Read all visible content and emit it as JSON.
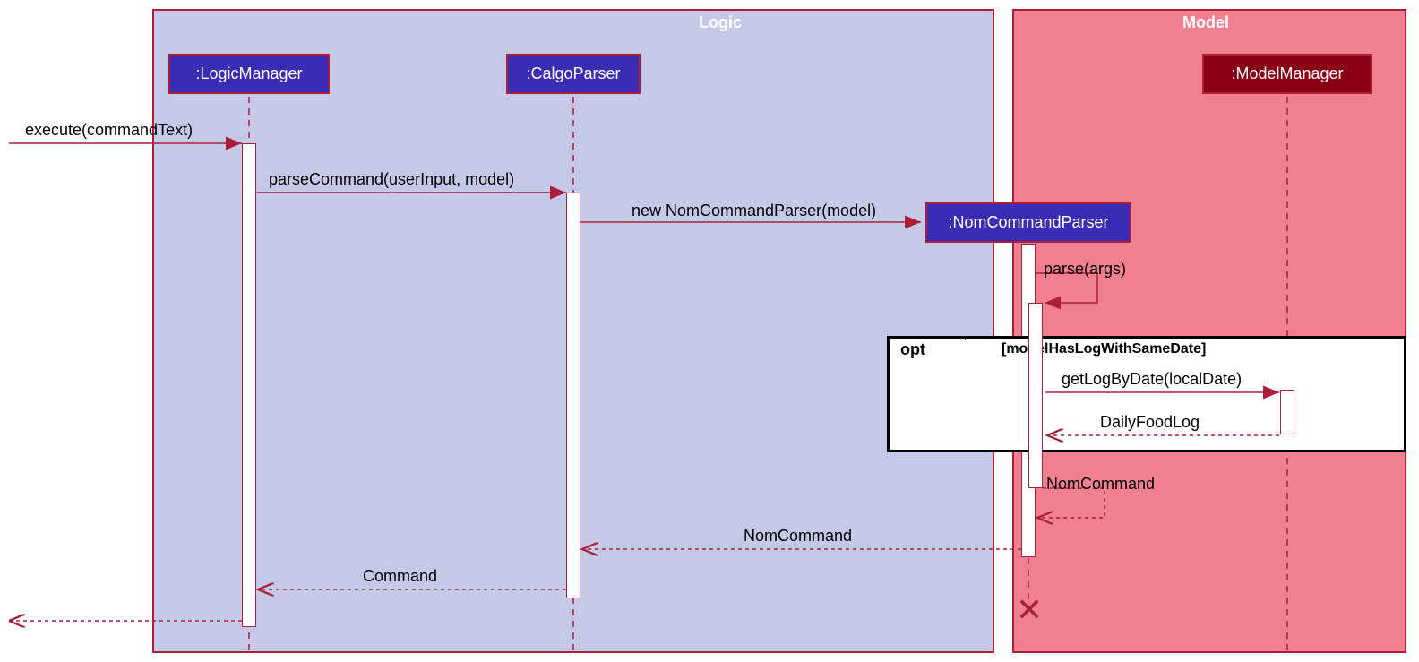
{
  "frames": {
    "logic_title": "Logic",
    "model_title": "Model"
  },
  "participants": {
    "logic_manager": ":LogicManager",
    "calgo_parser": ":CalgoParser",
    "nom_cmd_parser": ":NomCommandParser",
    "model_manager": ":ModelManager"
  },
  "messages": {
    "execute": "execute(commandText)",
    "parseCommand": "parseCommand(userInput, model)",
    "newParser": "new NomCommandParser(model)",
    "parseArgs": "parse(args)",
    "getLog": "getLogByDate(localDate)",
    "dailyFoodLog": "DailyFoodLog",
    "nomCommand1": "NomCommand",
    "nomCommand2": "NomCommand",
    "command": "Command"
  },
  "opt": {
    "keyword": "opt",
    "guard": "[modelHasLogWithSameDate]"
  }
}
